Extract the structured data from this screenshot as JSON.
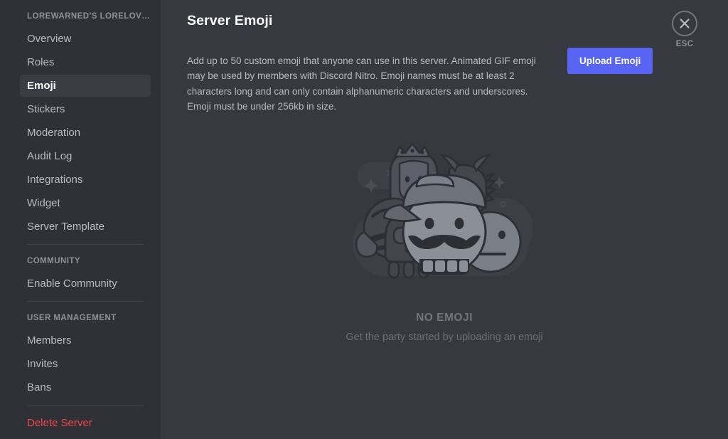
{
  "sidebar": {
    "server_name": "LOREWARNED'S LORELOV…",
    "groups": [
      {
        "header": null,
        "items": [
          {
            "label": "Overview",
            "active": false,
            "danger": false
          },
          {
            "label": "Roles",
            "active": false,
            "danger": false
          },
          {
            "label": "Emoji",
            "active": true,
            "danger": false
          },
          {
            "label": "Stickers",
            "active": false,
            "danger": false
          },
          {
            "label": "Moderation",
            "active": false,
            "danger": false
          },
          {
            "label": "Audit Log",
            "active": false,
            "danger": false
          },
          {
            "label": "Integrations",
            "active": false,
            "danger": false
          },
          {
            "label": "Widget",
            "active": false,
            "danger": false
          },
          {
            "label": "Server Template",
            "active": false,
            "danger": false
          }
        ]
      },
      {
        "header": "COMMUNITY",
        "items": [
          {
            "label": "Enable Community",
            "active": false,
            "danger": false
          }
        ]
      },
      {
        "header": "USER MANAGEMENT",
        "items": [
          {
            "label": "Members",
            "active": false,
            "danger": false
          },
          {
            "label": "Invites",
            "active": false,
            "danger": false
          },
          {
            "label": "Bans",
            "active": false,
            "danger": false
          }
        ]
      },
      {
        "header": null,
        "items": [
          {
            "label": "Delete Server",
            "active": false,
            "danger": true
          }
        ]
      }
    ]
  },
  "main": {
    "title": "Server Emoji",
    "description": "Add up to 50 custom emoji that anyone can use in this server. Animated GIF emoji may be used by members with Discord Nitro. Emoji names must be at least 2 characters long and can only contain alphanumeric characters and underscores. Emoji must be under 256kb in size.",
    "upload_button": "Upload Emoji",
    "empty_state": {
      "title": "NO EMOJI",
      "subtitle": "Get the party started by uploading an emoji",
      "illustration": "emoji-crowd-illustration"
    }
  },
  "close": {
    "icon": "close-x-icon",
    "label": "ESC"
  },
  "colors": {
    "accent": "#5865f2",
    "sidebar_bg": "#2f3136",
    "content_bg": "#36393f",
    "active_item_bg": "#393c43",
    "danger": "#f04747",
    "text_primary": "#ffffff",
    "text_secondary": "#b9bbbe",
    "text_muted": "#8e9297"
  }
}
